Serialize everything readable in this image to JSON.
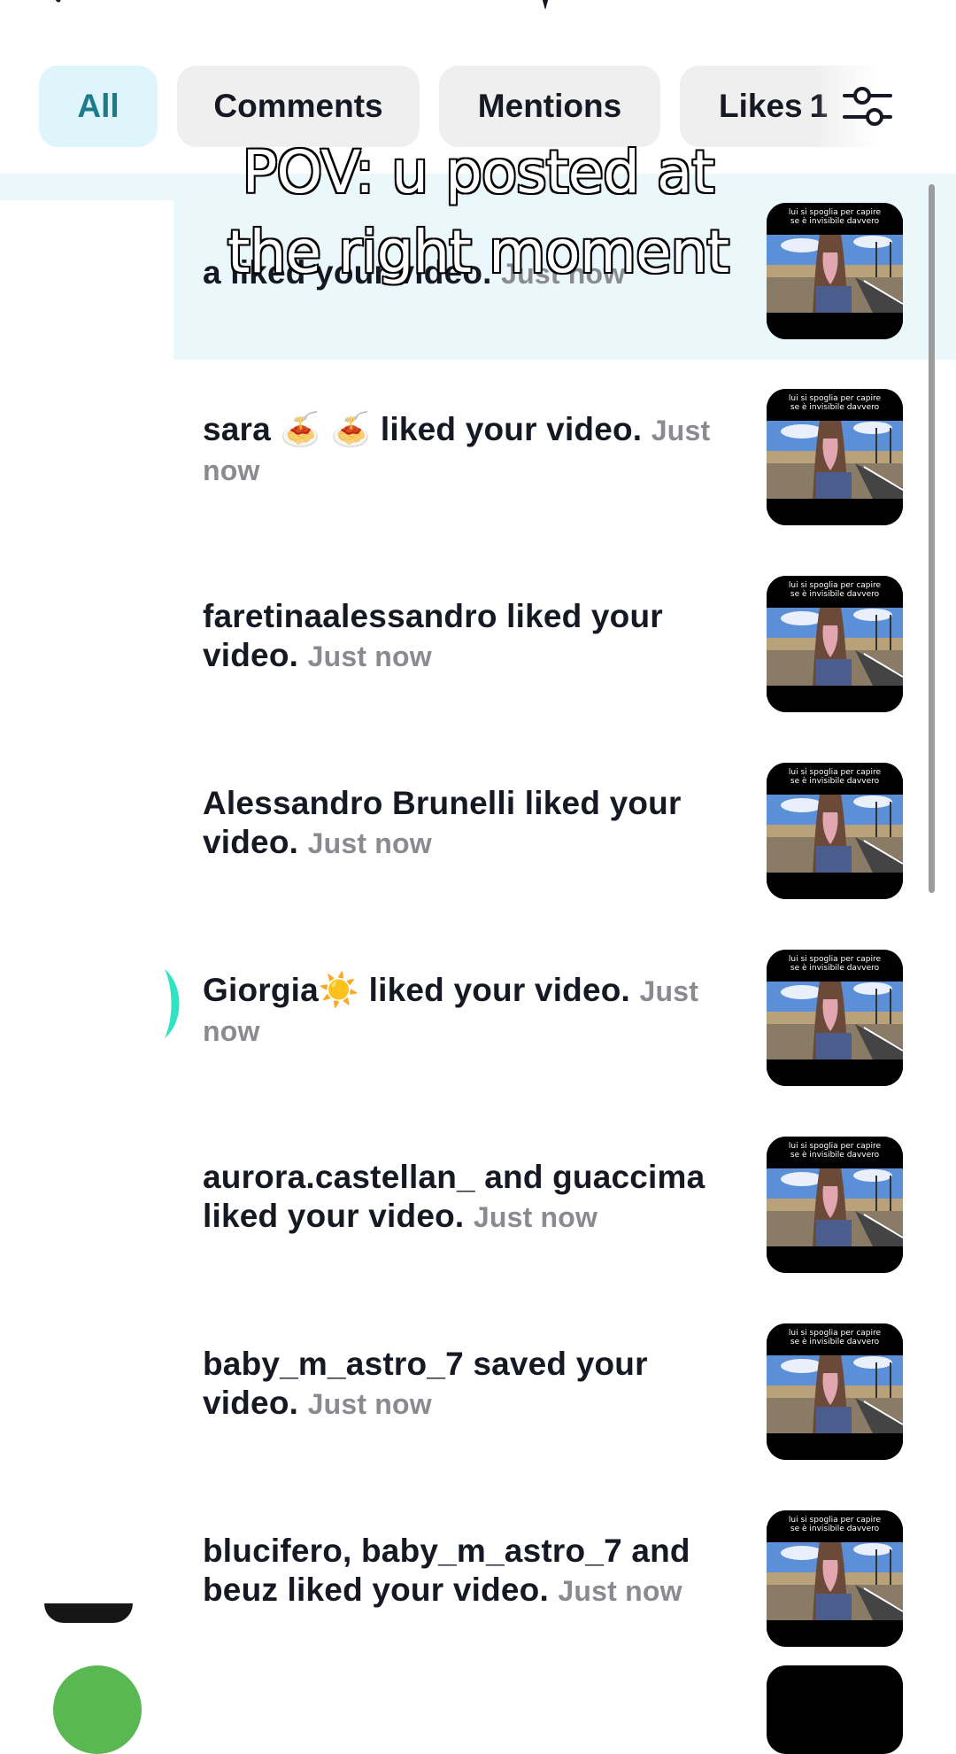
{
  "tabs": {
    "all": "All",
    "comments": "Comments",
    "mentions": "Mentions",
    "likes": "Likes",
    "likes_count": "1"
  },
  "overlay": {
    "line1": "POV: u posted at",
    "line2": "the right moment"
  },
  "thumbnail_caption": {
    "line1": "lui si spoglia per capire",
    "line2": "se è invisibile davvero"
  },
  "notifications": [
    {
      "text": "a liked your video.",
      "time": "Just now"
    },
    {
      "text": "sara 🍝 🍝 liked your video.",
      "time": "Just now"
    },
    {
      "text": "faretinaalessandro liked your video.",
      "time": "Just now"
    },
    {
      "text": "Alessandro Brunelli liked your video.",
      "time": "Just now"
    },
    {
      "text": "Giorgia☀️ liked your video.",
      "time": "Just now"
    },
    {
      "text": "aurora.castellan_ and guaccima liked your video.",
      "time": "Just now"
    },
    {
      "text": "baby_m_astro_7 saved your video.",
      "time": "Just now"
    },
    {
      "text": "blucifero, baby_m_astro_7 and beuz liked your video.",
      "time": "Just now"
    }
  ],
  "colors": {
    "active_tab_bg": "#def6fb",
    "active_tab_text": "#1b7b8a",
    "tab_bg": "#efefef",
    "highlight_row": "#eaf7fb",
    "time_text": "#8a8b91"
  },
  "icons": {
    "back": "back-chevron-icon",
    "filter": "filter-sliders-icon"
  }
}
